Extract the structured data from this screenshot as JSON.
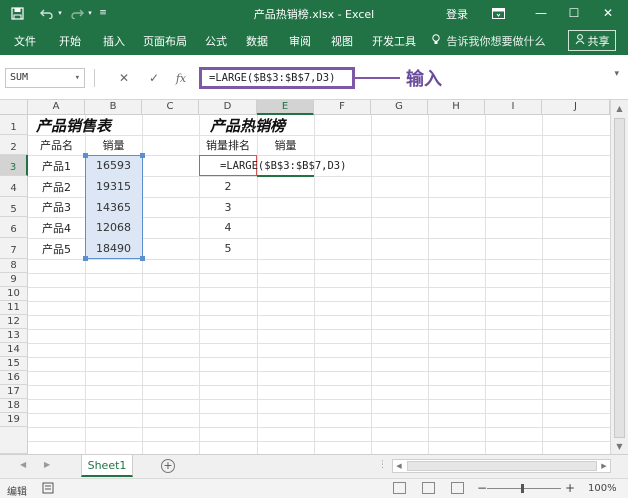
{
  "titlebar": {
    "save_icon": "save-icon",
    "undo_icon": "undo-icon",
    "redo_icon": "redo-icon",
    "title": "产品热销榜.xlsx  -  Excel",
    "login": "登录",
    "restore_icon": "restore-icon",
    "minimize": "—",
    "maximize": "☐",
    "close": "✕"
  },
  "ribbon": {
    "tabs": [
      "文件",
      "开始",
      "插入",
      "页面布局",
      "公式",
      "数据",
      "审阅",
      "视图",
      "开发工具"
    ],
    "tellme": "告诉我你想要做什么",
    "share": "共享"
  },
  "formula_bar": {
    "name_box": "SUM",
    "cancel": "✕",
    "enter": "✓",
    "fx": "fx",
    "formula": "=LARGE($B$3:$B$7,D3)",
    "callout": "输入"
  },
  "columns": [
    "A",
    "B",
    "C",
    "D",
    "E",
    "F",
    "G",
    "H",
    "I",
    "J"
  ],
  "rows": [
    "1",
    "2",
    "3",
    "4",
    "5",
    "6",
    "7",
    "8",
    "9",
    "10",
    "11",
    "12",
    "13",
    "14",
    "15",
    "16",
    "17",
    "18",
    "19"
  ],
  "sheet": {
    "title_left": "产品销售表",
    "title_right": "产品热销榜",
    "header_product": "产品名",
    "header_sales": "销量",
    "header_rank": "销量排名",
    "header_sales2": "销量",
    "products": [
      "产品1",
      "产品2",
      "产品3",
      "产品4",
      "产品5"
    ],
    "sales": [
      "16593",
      "19315",
      "14365",
      "12068",
      "18490"
    ],
    "ranks": [
      "2",
      "3",
      "4",
      "5"
    ],
    "editing_formula": "=LARGE($B$3:$B$7,D3)"
  },
  "sheetbar": {
    "tab": "Sheet1",
    "add": "+"
  },
  "statusbar": {
    "mode": "编辑",
    "zoom": "100%",
    "zoom_minus": "−",
    "zoom_plus": "+"
  },
  "colors": {
    "brand": "#217346",
    "callout": "#7e57a6",
    "selection": "#dce6f4"
  }
}
